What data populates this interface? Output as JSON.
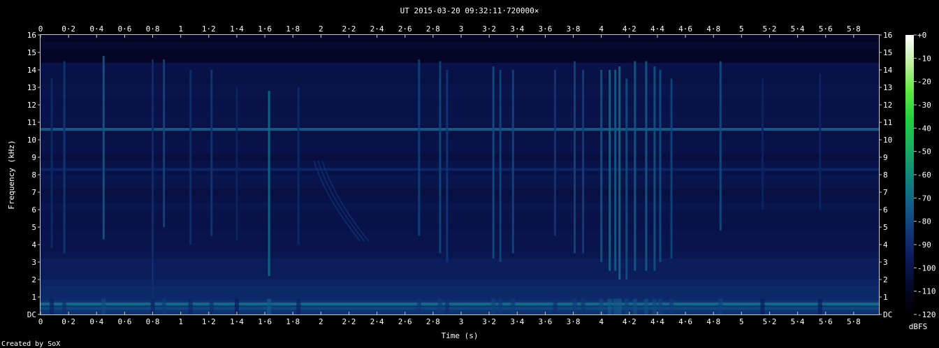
{
  "chart_data": {
    "type": "heatmap",
    "title": "UT 2015-03-20 09:32:11·720000×",
    "xlabel": "Time (s)",
    "ylabel": "Frequency (kHz)",
    "xlim": [
      0,
      5.98
    ],
    "ylim": [
      0,
      16
    ],
    "x_ticks": [
      "0",
      "0·2",
      "0·4",
      "0·6",
      "0·8",
      "1",
      "1·2",
      "1·4",
      "1·6",
      "1·8",
      "2",
      "2·2",
      "2·4",
      "2·6",
      "2·8",
      "3",
      "3·2",
      "3·4",
      "3·6",
      "3·8",
      "4",
      "4·2",
      "4·4",
      "4·6",
      "4·8",
      "5",
      "5·2",
      "5·4",
      "5·6",
      "5·8"
    ],
    "y_ticks": [
      "DC",
      "1",
      "2",
      "3",
      "4",
      "5",
      "6",
      "7",
      "8",
      "9",
      "10",
      "11",
      "12",
      "13",
      "14",
      "15",
      "16"
    ],
    "colorbar": {
      "label": "dBFS",
      "ticks": [
        "+0",
        "-10",
        "-20",
        "-30",
        "-40",
        "-50",
        "-60",
        "-70",
        "-80",
        "-90",
        "-100",
        "-110",
        "-120"
      ],
      "range": [
        -120,
        0
      ],
      "colors": [
        "#000000",
        "#06082a",
        "#0b1a5a",
        "#0f3a7a",
        "#11628a",
        "#128a7a",
        "#18b060",
        "#20d040",
        "#60e840",
        "#c0f0a0",
        "#ffffff"
      ]
    },
    "background_level_dbfs": -100,
    "horizontal_tones": [
      {
        "freq_khz": 10.6,
        "level_dbfs": -75
      },
      {
        "freq_khz": 8.3,
        "level_dbfs": -92
      },
      {
        "freq_khz": 0.6,
        "level_dbfs": -70
      },
      {
        "freq_khz": 0.35,
        "level_dbfs": -80
      }
    ],
    "vertical_transients": [
      {
        "t": 0.08,
        "fmax": 13.5,
        "fmin": 3.8,
        "level_dbfs": -90
      },
      {
        "t": 0.17,
        "fmax": 14.5,
        "fmin": 3.5,
        "level_dbfs": -85
      },
      {
        "t": 0.45,
        "fmax": 14.8,
        "fmin": 4.3,
        "level_dbfs": -75
      },
      {
        "t": 0.8,
        "fmax": 14.6,
        "fmin": 0.5,
        "level_dbfs": -88
      },
      {
        "t": 0.88,
        "fmax": 14.6,
        "fmin": 5.0,
        "level_dbfs": -80
      },
      {
        "t": 1.07,
        "fmax": 14.0,
        "fmin": 4.0,
        "level_dbfs": -88
      },
      {
        "t": 1.22,
        "fmax": 14.0,
        "fmin": 4.5,
        "level_dbfs": -85
      },
      {
        "t": 1.4,
        "fmax": 13.0,
        "fmin": 4.2,
        "level_dbfs": -92
      },
      {
        "t": 1.63,
        "fmax": 12.8,
        "fmin": 2.2,
        "level_dbfs": -70
      },
      {
        "t": 1.84,
        "fmax": 13.0,
        "fmin": 4.0,
        "level_dbfs": -90
      },
      {
        "t": 2.7,
        "fmax": 14.6,
        "fmin": 4.5,
        "level_dbfs": -82
      },
      {
        "t": 2.85,
        "fmax": 14.5,
        "fmin": 3.5,
        "level_dbfs": -80
      },
      {
        "t": 2.9,
        "fmax": 14.0,
        "fmin": 3.0,
        "level_dbfs": -85
      },
      {
        "t": 3.23,
        "fmax": 14.2,
        "fmin": 3.2,
        "level_dbfs": -78
      },
      {
        "t": 3.28,
        "fmax": 14.0,
        "fmin": 3.0,
        "level_dbfs": -80
      },
      {
        "t": 3.37,
        "fmax": 14.0,
        "fmin": 3.5,
        "level_dbfs": -80
      },
      {
        "t": 3.67,
        "fmax": 14.0,
        "fmin": 4.5,
        "level_dbfs": -85
      },
      {
        "t": 3.81,
        "fmax": 14.5,
        "fmin": 3.5,
        "level_dbfs": -80
      },
      {
        "t": 3.87,
        "fmax": 14.0,
        "fmin": 3.5,
        "level_dbfs": -82
      },
      {
        "t": 4.0,
        "fmax": 14.0,
        "fmin": 3.0,
        "level_dbfs": -76
      },
      {
        "t": 4.06,
        "fmax": 14.0,
        "fmin": 2.5,
        "level_dbfs": -70
      },
      {
        "t": 4.1,
        "fmax": 14.0,
        "fmin": 2.5,
        "level_dbfs": -72
      },
      {
        "t": 4.13,
        "fmax": 14.2,
        "fmin": 2.0,
        "level_dbfs": -70
      },
      {
        "t": 4.18,
        "fmax": 13.5,
        "fmin": 2.0,
        "level_dbfs": -78
      },
      {
        "t": 4.24,
        "fmax": 14.5,
        "fmin": 2.5,
        "level_dbfs": -74
      },
      {
        "t": 4.32,
        "fmax": 14.5,
        "fmin": 2.5,
        "level_dbfs": -74
      },
      {
        "t": 4.38,
        "fmax": 14.2,
        "fmin": 2.5,
        "level_dbfs": -76
      },
      {
        "t": 4.42,
        "fmax": 14.0,
        "fmin": 3.0,
        "level_dbfs": -78
      },
      {
        "t": 4.5,
        "fmax": 13.5,
        "fmin": 3.2,
        "level_dbfs": -80
      },
      {
        "t": 4.85,
        "fmax": 14.5,
        "fmin": 4.8,
        "level_dbfs": -78
      },
      {
        "t": 5.15,
        "fmax": 13.5,
        "fmin": 6.0,
        "level_dbfs": -92
      },
      {
        "t": 5.56,
        "fmax": 13.8,
        "fmin": 6.0,
        "level_dbfs": -92
      }
    ],
    "sweep": {
      "t_start": 1.95,
      "t_end": 2.28,
      "f_start_khz": 8.8,
      "f_end_khz": 4.2,
      "level_dbfs": -88
    }
  },
  "footer": {
    "credit": "Created by SoX"
  }
}
